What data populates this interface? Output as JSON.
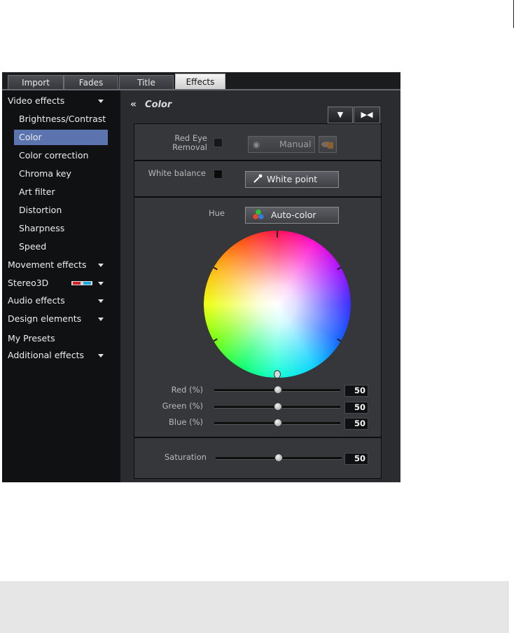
{
  "tabs": [
    {
      "label": "Import"
    },
    {
      "label": "Fades"
    },
    {
      "label": "Title"
    },
    {
      "label": "Effects",
      "active": true
    }
  ],
  "sidebar": {
    "items": [
      {
        "label": "Video effects",
        "type": "category",
        "expanded": true
      },
      {
        "label": "Brightness/Contrast",
        "type": "sub"
      },
      {
        "label": "Color",
        "type": "sub",
        "selected": true
      },
      {
        "label": "Color correction",
        "type": "sub"
      },
      {
        "label": "Chroma key",
        "type": "sub"
      },
      {
        "label": "Art filter",
        "type": "sub"
      },
      {
        "label": "Distortion",
        "type": "sub"
      },
      {
        "label": "Sharpness",
        "type": "sub"
      },
      {
        "label": "Speed",
        "type": "sub"
      },
      {
        "label": "Movement effects",
        "type": "category"
      },
      {
        "label": "Stereo3D",
        "type": "category"
      },
      {
        "label": "Audio effects",
        "type": "category"
      },
      {
        "label": "Design elements",
        "type": "category"
      },
      {
        "label": "My Presets",
        "type": "category"
      },
      {
        "label": "Additional effects",
        "type": "category"
      }
    ]
  },
  "panel": {
    "back_icon": "double-chevron-left-icon",
    "title": "Color",
    "red_eye": {
      "label_line1": "Red Eye",
      "label_line2": "Removal",
      "button": "Manual"
    },
    "white_balance": {
      "label": "White balance",
      "button": "White point"
    },
    "hue": {
      "label": "Hue",
      "button": "Auto-color"
    },
    "rgb": [
      {
        "label": "Red (%)",
        "value": "50"
      },
      {
        "label": "Green (%)",
        "value": "50"
      },
      {
        "label": "Blue (%)",
        "value": "50"
      }
    ],
    "saturation": {
      "label": "Saturation",
      "value": "50"
    }
  },
  "colors": {
    "selection": "#5b74b0",
    "panel_bg": "#2b2c2f",
    "sidebar_bg": "#101112"
  }
}
